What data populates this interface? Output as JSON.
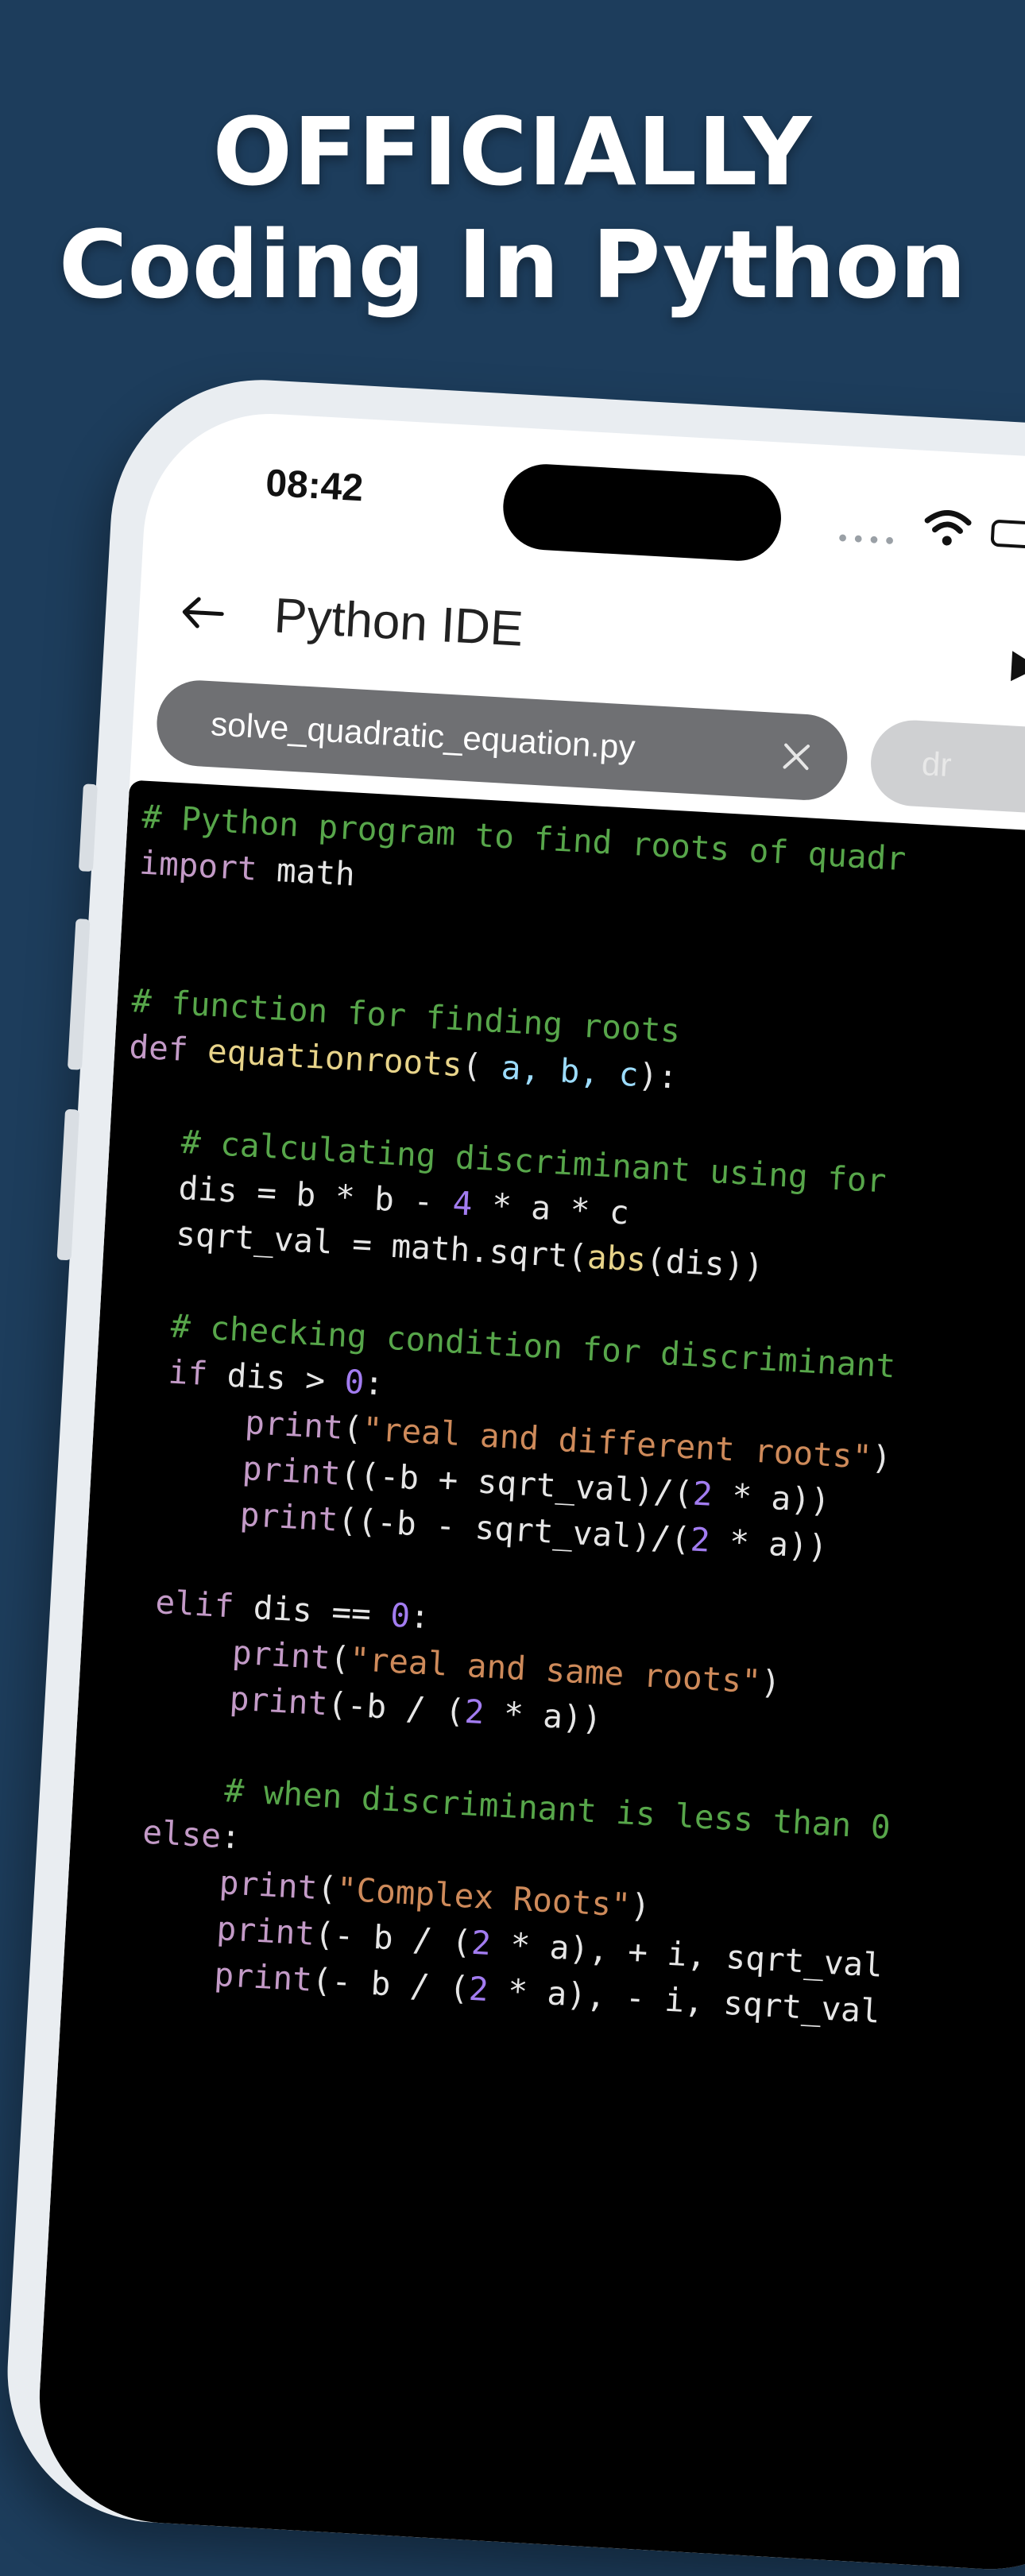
{
  "headline": {
    "line1": "OFFICIALLY",
    "line2": "Coding In Python"
  },
  "status_bar": {
    "time": "08:42",
    "dots": "••••"
  },
  "toolbar": {
    "title": "Python IDE",
    "icons": [
      "back-arrow-icon",
      "run-play-icon"
    ]
  },
  "tabs": {
    "active": "solve_quadratic_equation.py",
    "next": "dr"
  },
  "colors": {
    "background": "#1d3d5c",
    "editor_bg": "#000000",
    "keyword": "#c39ac7",
    "comment": "#57a64a",
    "function": "#e8d48a",
    "parameter": "#9cdcfe",
    "number": "#a27cf0",
    "string": "#ce8a5a"
  },
  "code": {
    "l1": "# Python program to find roots of quadr",
    "l2_kw": "import",
    "l2_rest": " math",
    "l3": "# function for finding roots",
    "l4_kw": "def",
    "l4_fn": " equationroots",
    "l4_open": "(",
    "l4_params": " a, b, c",
    "l4_close": "):",
    "l5": "# calculating discriminant using for",
    "l6_a": "dis = b * b - ",
    "l6_num": "4",
    "l6_b": " * a * c",
    "l7_a": "sqrt_val = math.sqrt(",
    "l7_fn": "abs",
    "l7_b": "(dis))",
    "l8": "# checking condition for discriminant",
    "l9_kw": "if",
    "l9_a": " dis > ",
    "l9_num": "0",
    "l9_b": ":",
    "l10_kw": "print",
    "l10_a": "(",
    "l10_str": "\"real and different roots\"",
    "l10_b": ")",
    "l11_kw": "print",
    "l11_a": "((-b + sqrt_val)/(",
    "l11_num": "2",
    "l11_b": " * a))",
    "l12_kw": "print",
    "l12_a": "((-b - sqrt_val)/(",
    "l12_num": "2",
    "l12_b": " * a))",
    "l13_kw": "elif",
    "l13_a": " dis == ",
    "l13_num": "0",
    "l13_b": ":",
    "l14_kw": "print",
    "l14_a": "(",
    "l14_str": "\"real and same roots\"",
    "l14_b": ")",
    "l15_kw": "print",
    "l15_a": "(-b / (",
    "l15_num": "2",
    "l15_b": " * a))",
    "l16": "# when discriminant is less than 0",
    "l17_kw": "else",
    "l17_b": ":",
    "l18_kw": "print",
    "l18_a": "(",
    "l18_str": "\"Complex Roots\"",
    "l18_b": ")",
    "l19_kw": "print",
    "l19_a": "(- b / (",
    "l19_num": "2",
    "l19_b": " * a), + i, sqrt_val",
    "l20_kw": "print",
    "l20_a": "(- b / (",
    "l20_num": "2",
    "l20_b": " * a), - i, sqrt_val"
  }
}
